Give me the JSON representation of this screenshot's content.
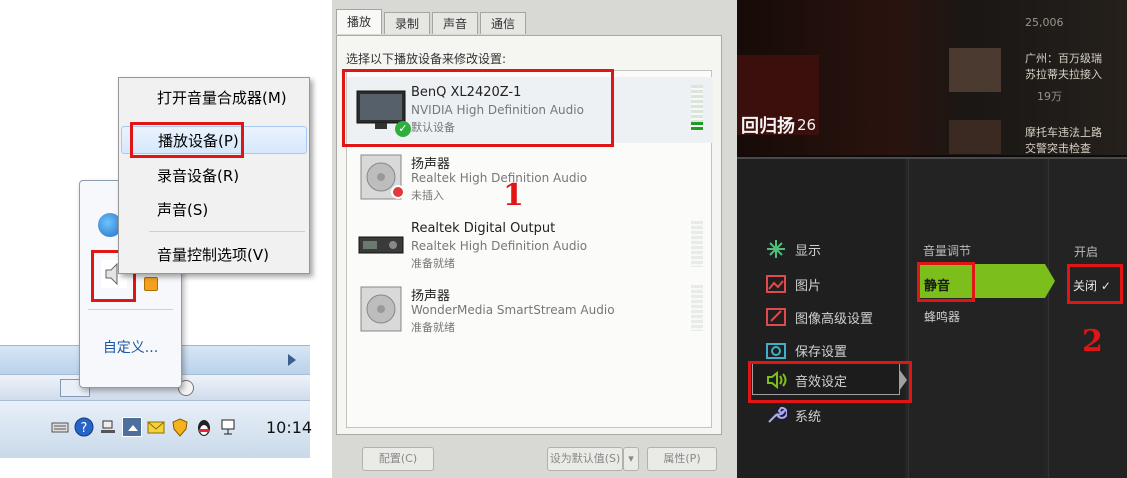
{
  "tray_menu": {
    "items": [
      {
        "label": "打开音量合成器(M)"
      },
      {
        "label": "播放设备(P)"
      },
      {
        "label": "录音设备(R)"
      },
      {
        "label": "声音(S)"
      },
      {
        "label": "音量控制选项(V)"
      }
    ],
    "customize_link": "自定义...",
    "clock": "10:14"
  },
  "sound_dialog": {
    "tabs": [
      "播放",
      "录制",
      "声音",
      "通信"
    ],
    "active_tab": "播放",
    "instruction": "选择以下播放设备来修改设置:",
    "devices": [
      {
        "name": "BenQ XL2420Z-1",
        "driver": "NVIDIA High Definition Audio",
        "status": "默认设备",
        "icon": "monitor-icon"
      },
      {
        "name": "扬声器",
        "driver": "Realtek High Definition Audio",
        "status": "未插入",
        "icon": "speaker-icon"
      },
      {
        "name": "Realtek Digital Output",
        "driver": "Realtek High Definition Audio",
        "status": "准备就绪",
        "icon": "receiver-icon"
      },
      {
        "name": "扬声器",
        "driver": "WonderMedia SmartStream Audio",
        "status": "准备就绪",
        "icon": "speaker-icon"
      }
    ],
    "buttons": {
      "configure": "配置(C)",
      "set_default": "设为默认值(S)",
      "properties": "属性(P)"
    },
    "annotation": "1"
  },
  "monitor_osd": {
    "menu": [
      {
        "label": "显示",
        "icon": "display-icon"
      },
      {
        "label": "图片",
        "icon": "picture-icon"
      },
      {
        "label": "图像高级设置",
        "icon": "advanced-picture-icon"
      },
      {
        "label": "保存设置",
        "icon": "save-settings-icon"
      },
      {
        "label": "音效设定",
        "icon": "audio-icon"
      },
      {
        "label": "系统",
        "icon": "wrench-icon"
      }
    ],
    "submenu_header": "音量调节",
    "submenu": [
      "静音",
      "蜂鸣器"
    ],
    "option_header": "开启",
    "option_selected": "关闭 ✓",
    "annotation": "2"
  },
  "background_news": {
    "count": "25,006",
    "headline_1": "广州：百万级瑞",
    "headline_1b": "苏拉蒂夫拉接入",
    "headline_2": "19万",
    "headline_3": "摩托车违法上路",
    "headline_3b": "交警突击检查",
    "sign_text": "回归扬",
    "sign_num": "26"
  },
  "colors": {
    "highlight_red": "#e01515",
    "osd_green": "#7cbf1d",
    "link_blue": "#1a56a8"
  }
}
